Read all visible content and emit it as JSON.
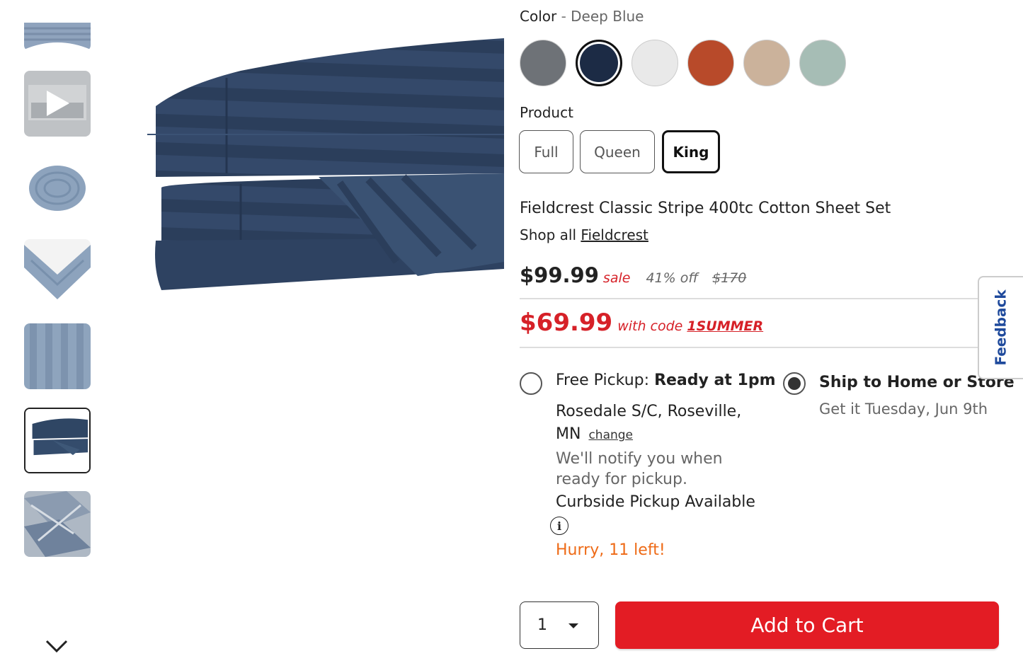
{
  "color": {
    "label": "Color",
    "separator": "-",
    "value": "Deep Blue"
  },
  "swatches": [
    {
      "name": "grey",
      "color": "#6e7277",
      "selected": false
    },
    {
      "name": "deep-blue",
      "color": "#1c2b45",
      "selected": true
    },
    {
      "name": "white",
      "color": "#e9e9e9",
      "selected": false
    },
    {
      "name": "rust",
      "color": "#b84a2a",
      "selected": false
    },
    {
      "name": "tan",
      "color": "#cbb29b",
      "selected": false
    },
    {
      "name": "sage",
      "color": "#a6bdb5",
      "selected": false
    }
  ],
  "product": {
    "label": "Product",
    "sizes": [
      "Full",
      "Queen",
      "King"
    ],
    "selected_size": "King",
    "title": "Fieldcrest Classic Stripe 400tc Cotton Sheet Set",
    "shop_all_prefix": "Shop all",
    "brand": "Fieldcrest"
  },
  "pricing": {
    "price": "$99.99",
    "sale_label": "sale",
    "discount": "41% off",
    "original": "$170",
    "code_price": "$69.99",
    "code_text": "with code",
    "code": "1SUMMER"
  },
  "fulfillment": {
    "pickup_label": "Free Pickup:",
    "pickup_time": "Ready at 1pm",
    "store": "Rosedale S/C, Roseville, MN",
    "change_label": "change",
    "notify": "We'll notify you when ready for pickup.",
    "curbside": "Curbside Pickup Available",
    "info_icon_glyph": "i",
    "stock": "Hurry, 11 left!",
    "ship_label": "Ship to Home or Store",
    "ship_date": "Get it Tuesday, Jun 9th",
    "selected": "ship"
  },
  "feedback": {
    "label": "Feedback"
  },
  "cart": {
    "quantity": "1",
    "add_label": "Add to Cart"
  },
  "thumbnails": [
    {
      "name": "thumb-fitted-corner"
    },
    {
      "name": "thumb-video"
    },
    {
      "name": "thumb-rolled-sheet"
    },
    {
      "name": "thumb-bed-corner"
    },
    {
      "name": "thumb-stripe-closeup"
    },
    {
      "name": "thumb-folded-stack"
    },
    {
      "name": "thumb-packaging"
    }
  ],
  "colors": {
    "accent_red": "#e31c24",
    "sale_red": "#d62128",
    "stock_orange": "#ee6a16",
    "feedback_blue": "#1f4a9c"
  }
}
